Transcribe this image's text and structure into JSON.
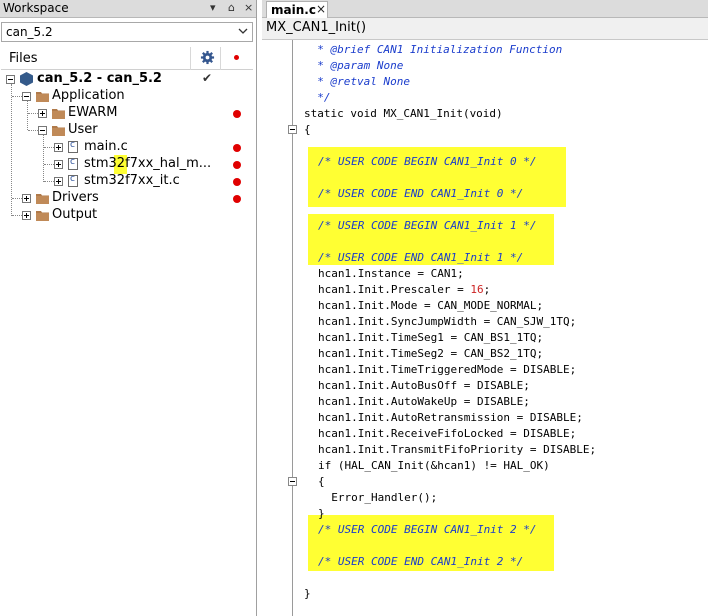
{
  "workspace": {
    "title": "Workspace",
    "pin": "▾  ⌂  ×",
    "config": "can_5.2",
    "files_header": "Files",
    "tree": {
      "project": "can_5.2 - can_5.2",
      "application": "Application",
      "ewarm": "EWARM",
      "user": "User",
      "main_c": "main.c",
      "hal_msp": "stm32f7xx_hal_m...",
      "it_c": "stm32f7xx_it.c",
      "drivers": "Drivers",
      "output": "Output"
    },
    "check": "✔"
  },
  "editor": {
    "tab_label": "main.c",
    "tab_close": "×",
    "function_bar": "MX_CAN1_Init()",
    "lines": {
      "l1": "  * @brief CAN1 Initialization Function",
      "l2": "  * @param None",
      "l3": "  * @retval None",
      "l4": "  */",
      "l5": "static void MX_CAN1_Init(void)",
      "l6": "{",
      "c1": "/* USER CODE BEGIN CAN1_Init 0 */",
      "c2": "/* USER CODE END CAN1_Init 0 */",
      "c3": "/* USER CODE BEGIN CAN1_Init 1 */",
      "c4": "/* USER CODE END CAN1_Init 1 */",
      "s1": "hcan1.Instance = CAN1;",
      "s2a": "hcan1.Init.Prescaler = ",
      "s2n": "16",
      "s2b": ";",
      "s3": "hcan1.Init.Mode = CAN_MODE_NORMAL;",
      "s4": "hcan1.Init.SyncJumpWidth = CAN_SJW_1TQ;",
      "s5": "hcan1.Init.TimeSeg1 = CAN_BS1_1TQ;",
      "s6": "hcan1.Init.TimeSeg2 = CAN_BS2_1TQ;",
      "s7": "hcan1.Init.TimeTriggeredMode = DISABLE;",
      "s8": "hcan1.Init.AutoBusOff = DISABLE;",
      "s9": "hcan1.Init.AutoWakeUp = DISABLE;",
      "s10": "hcan1.Init.AutoRetransmission = DISABLE;",
      "s11": "hcan1.Init.ReceiveFifoLocked = DISABLE;",
      "s12": "hcan1.Init.TransmitFifoPriority = DISABLE;",
      "s13": "if (HAL_CAN_Init(&hcan1) != HAL_OK)",
      "s14": "{",
      "s15": "  Error_Handler();",
      "s16": "}",
      "c5": "/* USER CODE BEGIN CAN1_Init 2 */",
      "c6": "/* USER CODE END CAN1_Init 2 */",
      "end": "}"
    }
  },
  "colors": {
    "highlight": "#ffff33",
    "comment": "#1a3ccc",
    "number": "#cc2222",
    "breakpoint": "#e00000"
  }
}
